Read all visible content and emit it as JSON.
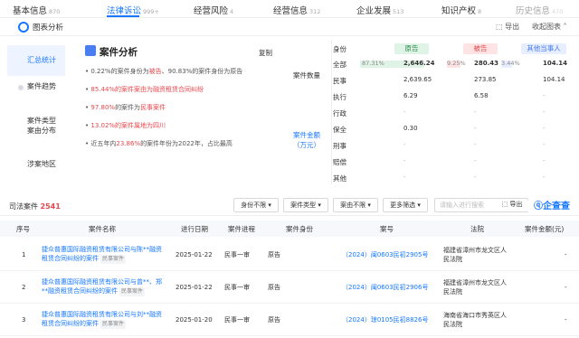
{
  "tabs": [
    {
      "label": "基本信息",
      "count": "870"
    },
    {
      "label": "法律诉讼",
      "count": "999+"
    },
    {
      "label": "经营风险",
      "count": "4"
    },
    {
      "label": "经营信息",
      "count": "312"
    },
    {
      "label": "企业发展",
      "count": "513"
    },
    {
      "label": "知识产权",
      "count": "8"
    },
    {
      "label": "历史信息",
      "count": "470"
    }
  ],
  "panel": {
    "title": "图表分析",
    "export": "导出",
    "collapse": "收起图表"
  },
  "sidebar": [
    "汇总统计",
    "案件趋势",
    "案件类型\n案由分布",
    "涉案地区"
  ],
  "analysis": {
    "title": "案件分析",
    "copy": "复制",
    "bullets": [
      {
        "pre": "0.22%的案件身份为",
        "hl": "被告",
        "post": "、90.83%的案件身份为原告"
      },
      {
        "pre": "",
        "hl": "85.44%的案件案由为融资租赁合同纠纷",
        "post": ""
      },
      {
        "pre": "",
        "hl": "97.80%",
        "post": "的案件为",
        "hl2": "民事案件"
      },
      {
        "pre": "",
        "hl": "13.02%的案件属地为四川",
        "post": ""
      },
      {
        "pre": "近五年内",
        "hl": "23.86%",
        "post": "的案件年份为2022年，占比最高"
      }
    ]
  },
  "stats": {
    "left_labels": [
      "案件数量",
      "案件金额\n（万元）"
    ],
    "columns": {
      "role": "身份",
      "plaintiff": "原告",
      "defendant": "被告",
      "other": "其他当事人"
    },
    "rows": [
      {
        "label": "全部",
        "p_pct": "87.31%",
        "p": "2,646.24",
        "d_pct": "9.25%",
        "d": "280.43",
        "o_pct": "3.44%",
        "o": "104.14"
      },
      {
        "label": "民事",
        "p_pct": "",
        "p": "2,639.65",
        "d_pct": "",
        "d": "273.85",
        "o_pct": "",
        "o": "104.14"
      },
      {
        "label": "执行",
        "p_pct": "",
        "p": "6.29",
        "d_pct": "",
        "d": "6.58",
        "o_pct": "",
        "o": "-"
      },
      {
        "label": "行政",
        "p_pct": "",
        "p": "-",
        "d_pct": "",
        "d": "-",
        "o_pct": "",
        "o": "-"
      },
      {
        "label": "保全",
        "p_pct": "",
        "p": "0.30",
        "d_pct": "",
        "d": "-",
        "o_pct": "",
        "o": "-"
      },
      {
        "label": "刑事",
        "p_pct": "",
        "p": "-",
        "d_pct": "",
        "d": "-",
        "o_pct": "",
        "o": "-"
      },
      {
        "label": "赔偿",
        "p_pct": "",
        "p": "-",
        "d_pct": "",
        "d": "-",
        "o_pct": "",
        "o": "-"
      },
      {
        "label": "其他",
        "p_pct": "",
        "p": "-",
        "d_pct": "",
        "d": "-",
        "o_pct": "",
        "o": "-"
      }
    ],
    "share": {
      "plaintiff": 0.8731,
      "defendant": 0.0925,
      "other": 0.0344
    }
  },
  "filter": {
    "title": "司法案件",
    "count": "2541",
    "buttons": [
      "身份不限",
      "案件类型",
      "案由不限",
      "更多筛选"
    ],
    "search_placeholder": "请输入进行搜索",
    "export": "导出",
    "logo": "企查查"
  },
  "table": {
    "headers": [
      "序号",
      "案件名称",
      "进行日期",
      "案件进程",
      "案件身份",
      "案号",
      "法院",
      "案件金额(元)"
    ],
    "rows": [
      {
        "no": "1",
        "name": "捷众普惠国际融资租赁有限公司与陈**融资租赁合同纠纷的案件",
        "tag": "民事案件",
        "date": "2025-01-22",
        "stage": "民事一审",
        "role": "原告",
        "case_no": "（2024）闽0603民初2905号",
        "court": "福建省漳州市龙文区人民法院",
        "amount": "-"
      },
      {
        "no": "2",
        "name": "捷众普惠国际融资租赁有限公司与曾**、郑**融资租赁合同纠纷的案件",
        "tag": "民事案件",
        "date": "2025-01-22",
        "stage": "民事一审",
        "role": "原告",
        "case_no": "（2024）闽0603民初2906号",
        "court": "福建省漳州市龙文区人民法院",
        "amount": "-"
      },
      {
        "no": "3",
        "name": "捷众普惠国际融资租赁有限公司与刘**融资租赁合同纠纷的案件",
        "tag": "民事案件",
        "date": "2025-01-20",
        "stage": "民事一审",
        "role": "原告",
        "case_no": "（2024）琼0105民初8826号",
        "court": "海南省海口市秀英区人民法院",
        "amount": "-"
      }
    ]
  },
  "colors": {
    "accent": "#1677ff",
    "red": "#e5484d",
    "plaintiff_bg": "#dff3e6",
    "defendant_bg": "#fde3e3",
    "other_bg": "#e6eeff"
  }
}
